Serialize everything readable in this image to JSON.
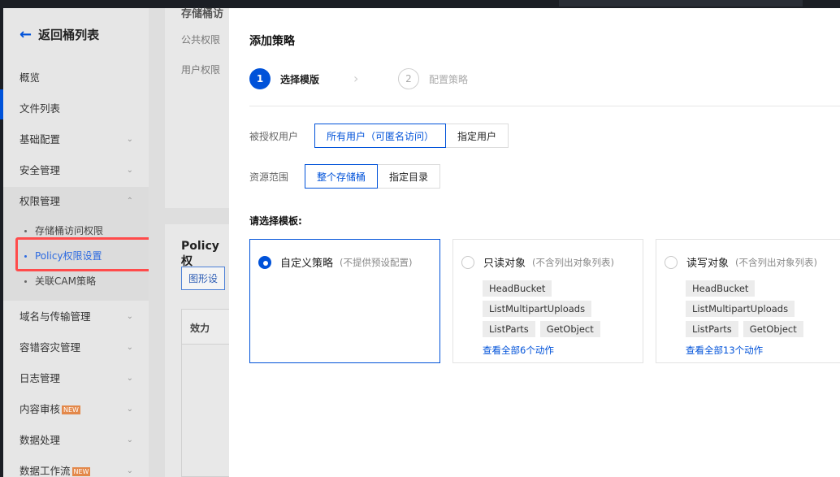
{
  "sidebar": {
    "back_label": "返回桶列表",
    "items": [
      {
        "label": "概览"
      },
      {
        "label": "文件列表"
      },
      {
        "label": "基础配置"
      },
      {
        "label": "安全管理"
      },
      {
        "label": "权限管理"
      },
      {
        "label": "域名与传输管理"
      },
      {
        "label": "容错容灾管理"
      },
      {
        "label": "日志管理"
      },
      {
        "label": "内容审核"
      },
      {
        "label": "数据处理"
      },
      {
        "label": "数据工作流"
      }
    ],
    "sub_items": [
      {
        "label": "存储桶访问权限"
      },
      {
        "label": "Policy权限设置"
      },
      {
        "label": "关联CAM策略"
      }
    ],
    "new_badge": "NEW",
    "highlight_color": "#ff4b4b"
  },
  "background_content": {
    "section_title_partial": "存储桶访",
    "public_perm_label": "公共权限",
    "user_perm_label": "用户权限",
    "policy_title_partial": "Policy权",
    "graph_btn_partial": "图形设",
    "effect_header": "效力"
  },
  "drawer": {
    "title": "添加策略",
    "steps": [
      {
        "number": "1",
        "label": "选择模版"
      },
      {
        "number": "2",
        "label": "配置策略"
      }
    ],
    "authorized_user": {
      "label": "被授权用户",
      "options": [
        "所有用户（可匿名访问）",
        "指定用户"
      ],
      "selected": "所有用户（可匿名访问）"
    },
    "resource_scope": {
      "label": "资源范围",
      "options": [
        "整个存储桶",
        "指定目录"
      ],
      "selected": "整个存储桶"
    },
    "template_title": "请选择模板:",
    "templates": [
      {
        "name": "自定义策略",
        "note": "(不提供预设配置)",
        "tags": [],
        "see_all": ""
      },
      {
        "name": "只读对象",
        "note": "(不含列出对象列表)",
        "tags": [
          "HeadBucket",
          "ListMultipartUploads",
          "ListParts",
          "GetObject"
        ],
        "see_all": "查看全部6个动作"
      },
      {
        "name": "读写对象",
        "note": "(不含列出对象列表)",
        "tags": [
          "HeadBucket",
          "ListMultipartUploads",
          "ListParts",
          "GetObject"
        ],
        "see_all": "查看全部13个动作"
      }
    ],
    "accent_color": "#0052d9"
  }
}
